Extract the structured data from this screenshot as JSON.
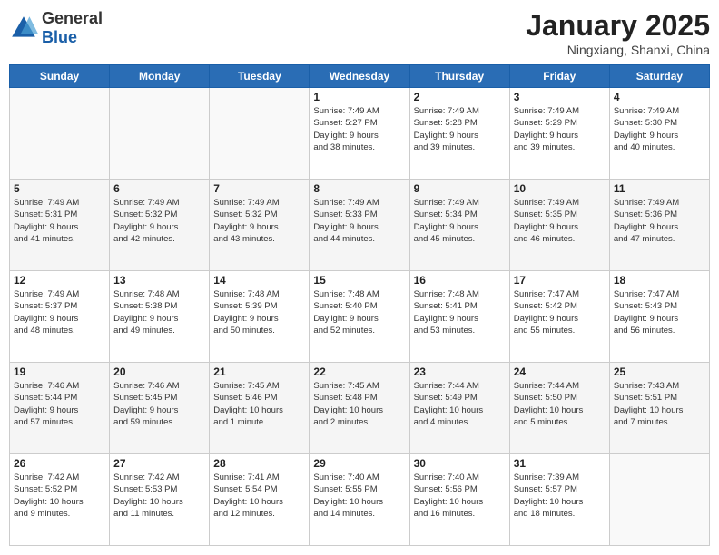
{
  "header": {
    "logo_general": "General",
    "logo_blue": "Blue",
    "month_title": "January 2025",
    "location": "Ningxiang, Shanxi, China"
  },
  "weekdays": [
    "Sunday",
    "Monday",
    "Tuesday",
    "Wednesday",
    "Thursday",
    "Friday",
    "Saturday"
  ],
  "rows": [
    [
      {
        "day": "",
        "info": ""
      },
      {
        "day": "",
        "info": ""
      },
      {
        "day": "",
        "info": ""
      },
      {
        "day": "1",
        "info": "Sunrise: 7:49 AM\nSunset: 5:27 PM\nDaylight: 9 hours\nand 38 minutes."
      },
      {
        "day": "2",
        "info": "Sunrise: 7:49 AM\nSunset: 5:28 PM\nDaylight: 9 hours\nand 39 minutes."
      },
      {
        "day": "3",
        "info": "Sunrise: 7:49 AM\nSunset: 5:29 PM\nDaylight: 9 hours\nand 39 minutes."
      },
      {
        "day": "4",
        "info": "Sunrise: 7:49 AM\nSunset: 5:30 PM\nDaylight: 9 hours\nand 40 minutes."
      }
    ],
    [
      {
        "day": "5",
        "info": "Sunrise: 7:49 AM\nSunset: 5:31 PM\nDaylight: 9 hours\nand 41 minutes."
      },
      {
        "day": "6",
        "info": "Sunrise: 7:49 AM\nSunset: 5:32 PM\nDaylight: 9 hours\nand 42 minutes."
      },
      {
        "day": "7",
        "info": "Sunrise: 7:49 AM\nSunset: 5:32 PM\nDaylight: 9 hours\nand 43 minutes."
      },
      {
        "day": "8",
        "info": "Sunrise: 7:49 AM\nSunset: 5:33 PM\nDaylight: 9 hours\nand 44 minutes."
      },
      {
        "day": "9",
        "info": "Sunrise: 7:49 AM\nSunset: 5:34 PM\nDaylight: 9 hours\nand 45 minutes."
      },
      {
        "day": "10",
        "info": "Sunrise: 7:49 AM\nSunset: 5:35 PM\nDaylight: 9 hours\nand 46 minutes."
      },
      {
        "day": "11",
        "info": "Sunrise: 7:49 AM\nSunset: 5:36 PM\nDaylight: 9 hours\nand 47 minutes."
      }
    ],
    [
      {
        "day": "12",
        "info": "Sunrise: 7:49 AM\nSunset: 5:37 PM\nDaylight: 9 hours\nand 48 minutes."
      },
      {
        "day": "13",
        "info": "Sunrise: 7:48 AM\nSunset: 5:38 PM\nDaylight: 9 hours\nand 49 minutes."
      },
      {
        "day": "14",
        "info": "Sunrise: 7:48 AM\nSunset: 5:39 PM\nDaylight: 9 hours\nand 50 minutes."
      },
      {
        "day": "15",
        "info": "Sunrise: 7:48 AM\nSunset: 5:40 PM\nDaylight: 9 hours\nand 52 minutes."
      },
      {
        "day": "16",
        "info": "Sunrise: 7:48 AM\nSunset: 5:41 PM\nDaylight: 9 hours\nand 53 minutes."
      },
      {
        "day": "17",
        "info": "Sunrise: 7:47 AM\nSunset: 5:42 PM\nDaylight: 9 hours\nand 55 minutes."
      },
      {
        "day": "18",
        "info": "Sunrise: 7:47 AM\nSunset: 5:43 PM\nDaylight: 9 hours\nand 56 minutes."
      }
    ],
    [
      {
        "day": "19",
        "info": "Sunrise: 7:46 AM\nSunset: 5:44 PM\nDaylight: 9 hours\nand 57 minutes."
      },
      {
        "day": "20",
        "info": "Sunrise: 7:46 AM\nSunset: 5:45 PM\nDaylight: 9 hours\nand 59 minutes."
      },
      {
        "day": "21",
        "info": "Sunrise: 7:45 AM\nSunset: 5:46 PM\nDaylight: 10 hours\nand 1 minute."
      },
      {
        "day": "22",
        "info": "Sunrise: 7:45 AM\nSunset: 5:48 PM\nDaylight: 10 hours\nand 2 minutes."
      },
      {
        "day": "23",
        "info": "Sunrise: 7:44 AM\nSunset: 5:49 PM\nDaylight: 10 hours\nand 4 minutes."
      },
      {
        "day": "24",
        "info": "Sunrise: 7:44 AM\nSunset: 5:50 PM\nDaylight: 10 hours\nand 5 minutes."
      },
      {
        "day": "25",
        "info": "Sunrise: 7:43 AM\nSunset: 5:51 PM\nDaylight: 10 hours\nand 7 minutes."
      }
    ],
    [
      {
        "day": "26",
        "info": "Sunrise: 7:42 AM\nSunset: 5:52 PM\nDaylight: 10 hours\nand 9 minutes."
      },
      {
        "day": "27",
        "info": "Sunrise: 7:42 AM\nSunset: 5:53 PM\nDaylight: 10 hours\nand 11 minutes."
      },
      {
        "day": "28",
        "info": "Sunrise: 7:41 AM\nSunset: 5:54 PM\nDaylight: 10 hours\nand 12 minutes."
      },
      {
        "day": "29",
        "info": "Sunrise: 7:40 AM\nSunset: 5:55 PM\nDaylight: 10 hours\nand 14 minutes."
      },
      {
        "day": "30",
        "info": "Sunrise: 7:40 AM\nSunset: 5:56 PM\nDaylight: 10 hours\nand 16 minutes."
      },
      {
        "day": "31",
        "info": "Sunrise: 7:39 AM\nSunset: 5:57 PM\nDaylight: 10 hours\nand 18 minutes."
      },
      {
        "day": "",
        "info": ""
      }
    ]
  ]
}
